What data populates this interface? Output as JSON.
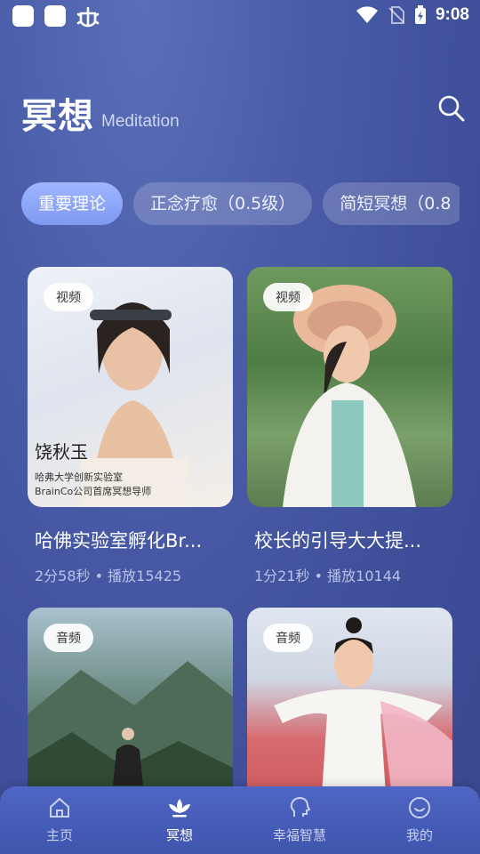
{
  "status_bar": {
    "time": "9:08"
  },
  "header": {
    "title": "冥想",
    "subtitle": "Meditation",
    "search_icon": "search-icon"
  },
  "tabs": [
    {
      "label": "重要理论",
      "active": true
    },
    {
      "label": "正念疗愈（0.5级）",
      "active": false
    },
    {
      "label": "简短冥想（0.8",
      "active": false
    }
  ],
  "cards": [
    {
      "badge": "视频",
      "title": "哈佛实验室孵化Br...",
      "duration": "2分58秒",
      "plays": "播放15425",
      "overlay_name": "饶秋玉",
      "overlay_line1": "哈弗大学创新实验室",
      "overlay_line2": "BrainCo公司首席冥想导师"
    },
    {
      "badge": "视频",
      "title": "校长的引导大大提...",
      "duration": "1分21秒",
      "plays": "播放10144"
    },
    {
      "badge": "音频"
    },
    {
      "badge": "音频"
    }
  ],
  "separator": "•",
  "tabbar": [
    {
      "label": "主页",
      "icon": "home-icon",
      "active": false
    },
    {
      "label": "冥想",
      "icon": "lotus-icon",
      "active": true
    },
    {
      "label": "幸福智慧",
      "icon": "head-icon",
      "active": false
    },
    {
      "label": "我的",
      "icon": "smile-icon",
      "active": false
    }
  ],
  "colors": {
    "accent": "#8aa3f7",
    "background": "#4a5ca8",
    "meta_text": "#b9c3e8"
  }
}
